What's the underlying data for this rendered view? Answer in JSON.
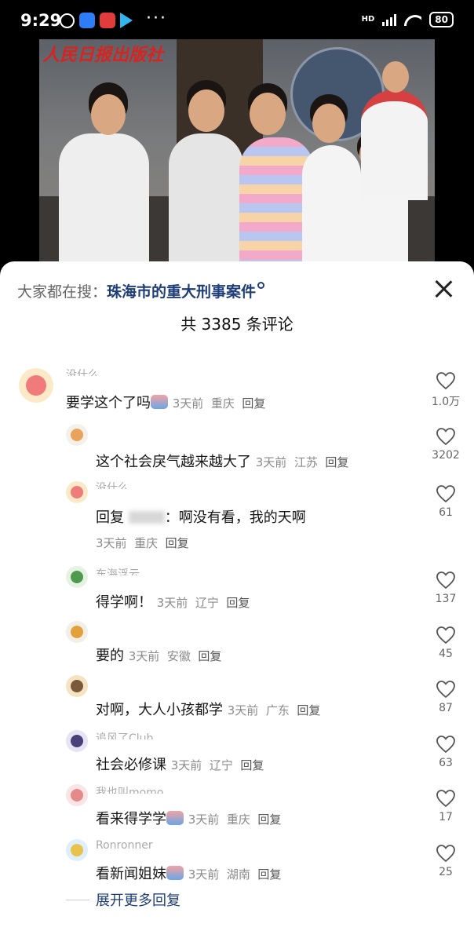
{
  "status_bar": {
    "time": "9:29",
    "dots": "···",
    "network": "HD",
    "battery": "80"
  },
  "video": {
    "watermark": "人民日报出版社"
  },
  "sheet": {
    "search_prefix": "大家都在搜：",
    "search_keyword": "珠海市的重大刑事案件",
    "comment_count_title": "共 3385 条评论"
  },
  "comments": [
    {
      "username": "没什么",
      "text": "要学这个了吗",
      "emoji": true,
      "time": "3天前",
      "location": "重庆",
      "reply": "回复",
      "likes": "1.0万",
      "level": 0
    },
    {
      "username": "",
      "text": "这个社会戾气越来越大了",
      "emoji": false,
      "time": "3天前",
      "location": "江苏",
      "reply": "回复",
      "likes": "3202",
      "level": 1
    },
    {
      "username": "没什么",
      "text_prefix": "回复",
      "text_suffix": "：啊没有看，我的天啊",
      "time": "3天前",
      "location": "重庆",
      "reply": "回复",
      "likes": "61",
      "level": 1
    },
    {
      "username": "东海浮云",
      "text": "得学啊！",
      "emoji": false,
      "time": "3天前",
      "location": "辽宁",
      "reply": "回复",
      "likes": "137",
      "level": 1
    },
    {
      "username": "",
      "text": "要的",
      "emoji": false,
      "time": "3天前",
      "location": "安徽",
      "reply": "回复",
      "likes": "45",
      "level": 1
    },
    {
      "username": "",
      "text": "对啊，大人小孩都学",
      "emoji": false,
      "time": "3天前",
      "location": "广东",
      "reply": "回复",
      "likes": "87",
      "level": 1
    },
    {
      "username": "追风了Club",
      "text": "社会必修课",
      "emoji": false,
      "time": "3天前",
      "location": "辽宁",
      "reply": "回复",
      "likes": "63",
      "level": 1
    },
    {
      "username": "我也叫momo",
      "text": "看来得学学",
      "emoji": true,
      "time": "3天前",
      "location": "重庆",
      "reply": "回复",
      "likes": "17",
      "level": 1
    },
    {
      "username": "Ronronner",
      "text": "看新闻姐妹",
      "emoji": true,
      "time": "3天前",
      "location": "湖南",
      "reply": "回复",
      "likes": "25",
      "level": 1
    }
  ],
  "expand_label": "展开更多回复",
  "colors": {
    "keyword": "#1f3e78",
    "meta": "#8a8a8a",
    "background": "#ffffff"
  },
  "icons": {
    "close": "close-icon",
    "like": "heart-outline-icon",
    "search_mark": "search-icon"
  }
}
